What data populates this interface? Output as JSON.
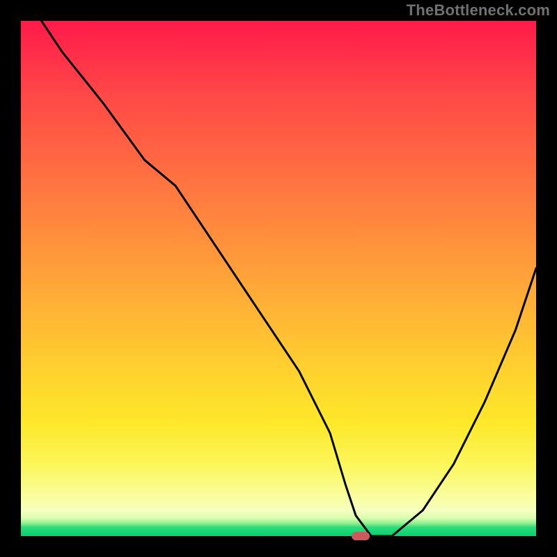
{
  "watermark": "TheBottleneck.com",
  "colors": {
    "frame": "#000000",
    "watermark": "#717171",
    "curve": "#000000",
    "marker": "#cc5a5d"
  },
  "chart_data": {
    "type": "line",
    "title": "",
    "xlabel": "",
    "ylabel": "",
    "xlim": [
      0,
      100
    ],
    "ylim": [
      0,
      100
    ],
    "series": [
      {
        "name": "bottleneck-curve",
        "x": [
          4,
          8,
          16,
          24,
          30,
          38,
          46,
          54,
          60,
          63,
          65,
          68,
          72,
          78,
          84,
          90,
          96,
          100
        ],
        "values": [
          100,
          94,
          84,
          73,
          68,
          56,
          44,
          32,
          20,
          10,
          4,
          0,
          0,
          5,
          14,
          26,
          40,
          52
        ]
      }
    ],
    "marker": {
      "x": 66,
      "y": 0
    },
    "gradient_stops": [
      {
        "pct": 0,
        "color": "#ff1a4a"
      },
      {
        "pct": 28,
        "color": "#ff6b42"
      },
      {
        "pct": 56,
        "color": "#ffb336"
      },
      {
        "pct": 78,
        "color": "#fde82a"
      },
      {
        "pct": 95,
        "color": "#f6ffc0"
      },
      {
        "pct": 100,
        "color": "#06d06e"
      }
    ]
  }
}
